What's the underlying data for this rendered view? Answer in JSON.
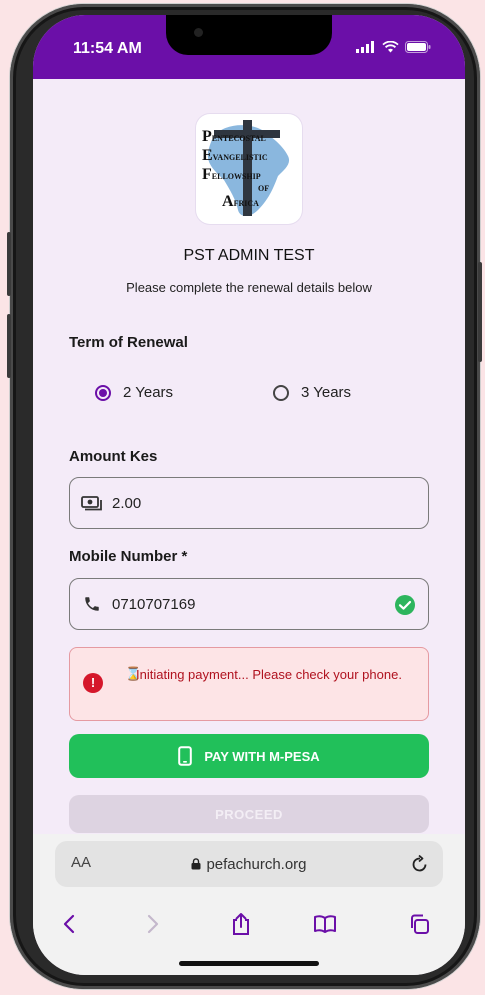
{
  "status_bar": {
    "time": "11:54 AM",
    "icons": [
      "signal-icon",
      "wifi-icon",
      "battery-icon"
    ]
  },
  "logo": {
    "lines": [
      {
        "initial": "P",
        "rest": "ENTECOSTAL"
      },
      {
        "initial": "E",
        "rest": "VANGELISTIC"
      },
      {
        "initial": "F",
        "rest": "ELLOWSHIP"
      },
      {
        "initial": "",
        "rest": "OF"
      },
      {
        "initial": "A",
        "rest": "FRICA"
      }
    ]
  },
  "header": {
    "title": "PST ADMIN TEST",
    "subtitle": "Please complete the renewal details below"
  },
  "term": {
    "label": "Term of Renewal",
    "options": [
      {
        "label": "2 Years",
        "selected": true
      },
      {
        "label": "3 Years",
        "selected": false
      }
    ]
  },
  "amount": {
    "label": "Amount Kes",
    "value": "2.00",
    "icon": "cash-icon"
  },
  "mobile": {
    "label": "Mobile Number *",
    "value": "0710707169",
    "icon": "phone-icon",
    "valid_icon": "check-circle-icon"
  },
  "alert": {
    "icon": "error-icon",
    "hourglass": "⌛",
    "message": "Initiating payment... Please check your phone."
  },
  "buttons": {
    "pay_label": "PAY WITH M-PESA",
    "proceed_label": "PROCEED"
  },
  "browser": {
    "text_size_label": "AA",
    "url": "pefachurch.org"
  },
  "colors": {
    "primary": "#6b0fa8",
    "success": "#21c05a",
    "error": "#d5172b",
    "background": "#f4ebf8"
  }
}
